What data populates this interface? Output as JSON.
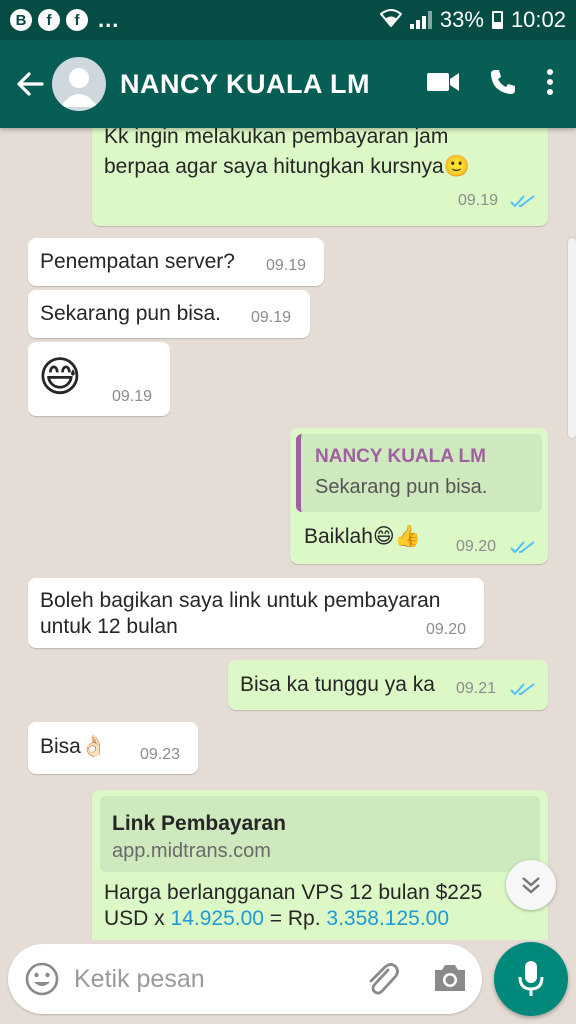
{
  "status_bar": {
    "icons": [
      "b-icon",
      "facebook-icon",
      "facebook-icon"
    ],
    "b_letter": "B",
    "fb_letter": "f",
    "more": "...",
    "battery": "33%",
    "time": "10:02"
  },
  "header": {
    "contact_name": "NANCY KUALA LM",
    "colors": {
      "appbar": "#075e54",
      "statusbar": "#054d44"
    }
  },
  "messages": [
    {
      "dir": "out",
      "text_lines": [
        "Kk ingin melakukan pembayaran jam",
        "berpaa agar saya hitungkan kursnya🙂"
      ],
      "time": "09.19",
      "read": true
    },
    {
      "dir": "in",
      "text": "Penempatan server?",
      "time": "09.19"
    },
    {
      "dir": "in",
      "text": "Sekarang pun bisa.",
      "time": "09.19"
    },
    {
      "dir": "in",
      "text": "😅",
      "time": "09.19"
    },
    {
      "dir": "out",
      "quote": {
        "name": "NANCY KUALA LM",
        "text": "Sekarang pun bisa."
      },
      "text": "Baiklah😄👍",
      "time": "09.20",
      "read": true
    },
    {
      "dir": "in",
      "text_lines": [
        "Boleh bagikan saya link untuk pembayaran",
        "untuk 12 bulan"
      ],
      "time": "09.20"
    },
    {
      "dir": "out",
      "text": "Bisa ka tunggu ya ka",
      "time": "09.21",
      "read": true
    },
    {
      "dir": "in",
      "text": "Bisa👌🏻",
      "time": "09.23"
    },
    {
      "dir": "out",
      "link": {
        "title": "Link Pembayaran",
        "url": "app.midtrans.com"
      },
      "text_line1": "Harga berlangganan VPS 12 bulan $225",
      "text_line2": {
        "prefix": "USD x ",
        "rate": "14.925.00",
        "middle": " = Rp. ",
        "total": "3.358.125.00"
      }
    }
  ],
  "composer": {
    "placeholder": "Ketik pesan"
  },
  "colors": {
    "incoming": "#ffffff",
    "outgoing": "#dcf8c6",
    "read_ticks": "#4fc3f7",
    "link_blue": "#1e9bd7",
    "quote_name": "#a05fa0",
    "mic_button": "#00897b"
  }
}
